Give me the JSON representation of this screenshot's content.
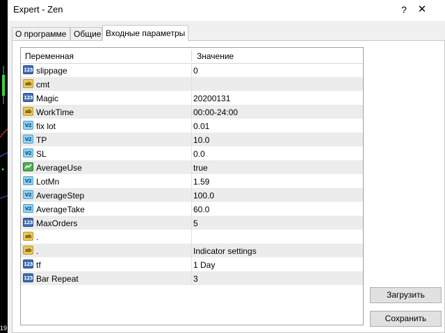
{
  "background": {
    "bottom_label": "19"
  },
  "window": {
    "title": "Expert - Zen",
    "help": "?",
    "close": "✕"
  },
  "tabs": [
    {
      "label": "О программе"
    },
    {
      "label": "Общие"
    },
    {
      "label": "Входные параметры",
      "active": true
    }
  ],
  "grid": {
    "headers": {
      "variable": "Переменная",
      "value": "Значение"
    },
    "rows": [
      {
        "type": "int",
        "type_label": "123",
        "name": "slippage",
        "value": "0"
      },
      {
        "type": "str",
        "type_label": "ab",
        "name": "cmt",
        "value": ""
      },
      {
        "type": "int",
        "type_label": "123",
        "name": "Magic",
        "value": "20200131"
      },
      {
        "type": "str",
        "type_label": "ab",
        "name": "WorkTime",
        "value": "00:00-24:00"
      },
      {
        "type": "dbl",
        "type_label": "V2",
        "name": "fix lot",
        "value": "0.01"
      },
      {
        "type": "dbl",
        "type_label": "V2",
        "name": "TP",
        "value": "10.0"
      },
      {
        "type": "dbl",
        "type_label": "V2",
        "name": "SL",
        "value": "0.0"
      },
      {
        "type": "bool",
        "type_label": "",
        "name": "AverageUse",
        "value": "true"
      },
      {
        "type": "dbl",
        "type_label": "V2",
        "name": "LotMn",
        "value": "1.59"
      },
      {
        "type": "dbl",
        "type_label": "V2",
        "name": "AverageStep",
        "value": "100.0"
      },
      {
        "type": "dbl",
        "type_label": "V2",
        "name": "AverageTake",
        "value": "60.0"
      },
      {
        "type": "int",
        "type_label": "123",
        "name": "MaxOrders",
        "value": "5"
      },
      {
        "type": "str",
        "type_label": "ab",
        "name": ".",
        "value": ""
      },
      {
        "type": "str",
        "type_label": "ab",
        "name": ".",
        "value": "Indicator settings"
      },
      {
        "type": "int",
        "type_label": "123",
        "name": "tf",
        "value": "1 Day"
      },
      {
        "type": "int",
        "type_label": "123",
        "name": "Bar Repeat",
        "value": "3"
      }
    ]
  },
  "buttons": {
    "load": "Загрузить",
    "save": "Сохранить"
  }
}
